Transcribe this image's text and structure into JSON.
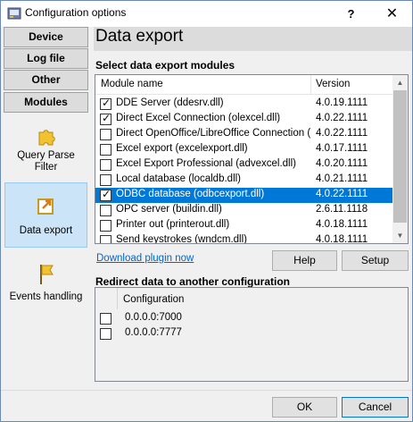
{
  "window": {
    "title": "Configuration options",
    "help_glyph": "?",
    "close_glyph": "✕",
    "icon": "app-gear-icon"
  },
  "sidebar": {
    "tabs": [
      {
        "label": "Device"
      },
      {
        "label": "Log file"
      },
      {
        "label": "Other"
      },
      {
        "label": "Modules"
      }
    ],
    "items": [
      {
        "label": "Query Parse Filter",
        "line1": "Query Parse",
        "line2": "Filter",
        "icon": "puzzle-icon",
        "selected": false
      },
      {
        "label": "Data export",
        "icon": "export-arrow-icon",
        "selected": true
      },
      {
        "label": "Events handling",
        "icon": "flag-icon",
        "selected": false
      }
    ]
  },
  "main": {
    "title": "Data export",
    "modules_section_label": "Select data export modules",
    "columns": [
      "Module name",
      "Version"
    ],
    "modules": [
      {
        "name": "DDE Server (ddesrv.dll)",
        "version": "4.0.19.1111",
        "checked": true,
        "selected": false
      },
      {
        "name": "Direct Excel Connection (olexcel.dll)",
        "version": "4.0.22.1111",
        "checked": true,
        "selected": false
      },
      {
        "name": "Direct OpenOffice/LibreOffice Connection (...",
        "version": "4.0.22.1111",
        "checked": false,
        "selected": false
      },
      {
        "name": "Excel export (excelexport.dll)",
        "version": "4.0.17.1111",
        "checked": false,
        "selected": false
      },
      {
        "name": "Excel Export Professional (advexcel.dll)",
        "version": "4.0.20.1111",
        "checked": false,
        "selected": false
      },
      {
        "name": "Local database (localdb.dll)",
        "version": "4.0.21.1111",
        "checked": false,
        "selected": false
      },
      {
        "name": "ODBC database (odbcexport.dll)",
        "version": "4.0.22.1111",
        "checked": true,
        "selected": true
      },
      {
        "name": "OPC server (buildin.dll)",
        "version": "2.6.11.1118",
        "checked": false,
        "selected": false
      },
      {
        "name": "Printer out (printerout.dll)",
        "version": "4.0.18.1111",
        "checked": false,
        "selected": false
      },
      {
        "name": "Send keystrokes (wndcm.dll)",
        "version": "4.0.18.1111",
        "checked": false,
        "selected": false
      }
    ],
    "download_link": "Download plugin now",
    "help_button": "Help",
    "setup_button": "Setup",
    "redirect_section_label": "Redirect data to another configuration",
    "redirect_column": "Configuration",
    "redirects": [
      {
        "name": "0.0.0.0:7000",
        "checked": false
      },
      {
        "name": "0.0.0.0:7777",
        "checked": false
      }
    ]
  },
  "footer": {
    "ok_button": "OK",
    "cancel_button": "Cancel"
  },
  "colors": {
    "selection": "#0078d7",
    "link": "#0066cc",
    "sidebar_selected": "#cce4f7"
  }
}
